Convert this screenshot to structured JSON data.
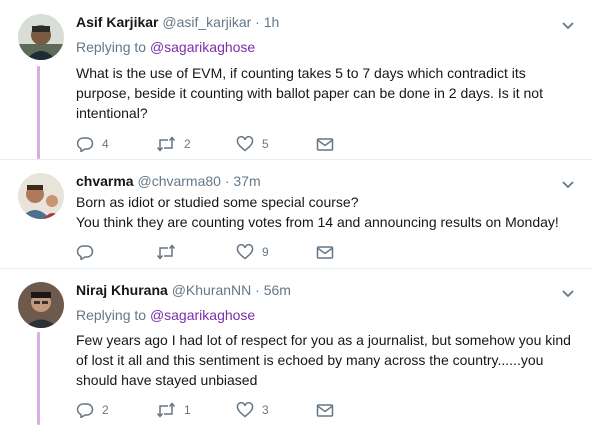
{
  "tweets": [
    {
      "name": "Asif Karjikar",
      "handle": "@asif_karjikar",
      "time": "· 1h",
      "replying_label": "Replying to",
      "replying_handle": "@sagarikaghose",
      "lines": [
        "What is the use of EVM,  if counting takes 5 to 7 days which contradict its",
        "purpose, beside it counting with ballot paper can be done in 2 days. Is it not",
        "intentional?"
      ],
      "replies": "4",
      "retweets": "2",
      "likes": "5"
    },
    {
      "name": "chvarma",
      "handle": "@chvarma80",
      "time": "· 37m",
      "lines": [
        "Born as idiot or studied some special course?",
        "You think they are counting votes from 14 and announcing results on Monday!"
      ],
      "replies": "",
      "retweets": "",
      "likes": "9"
    },
    {
      "name": "Niraj Khurana",
      "handle": "@KhuranNN",
      "time": "· 56m",
      "replying_label": "Replying to",
      "replying_handle": "@sagarikaghose",
      "lines": [
        "Few years ago I had lot of respect for you as a journalist, but somehow you kind",
        "of lost it all and this sentiment is echoed by many across the country......you",
        "should have stayed unbiased"
      ],
      "replies": "2",
      "retweets": "1",
      "likes": "3"
    }
  ],
  "colors": {
    "thread_line": "#d8aee2",
    "link_handle": "#7b2ea8",
    "meta_text": "#657786"
  },
  "icons": [
    "chevron-down-icon",
    "reply-icon",
    "retweet-icon",
    "heart-icon",
    "envelope-icon"
  ]
}
